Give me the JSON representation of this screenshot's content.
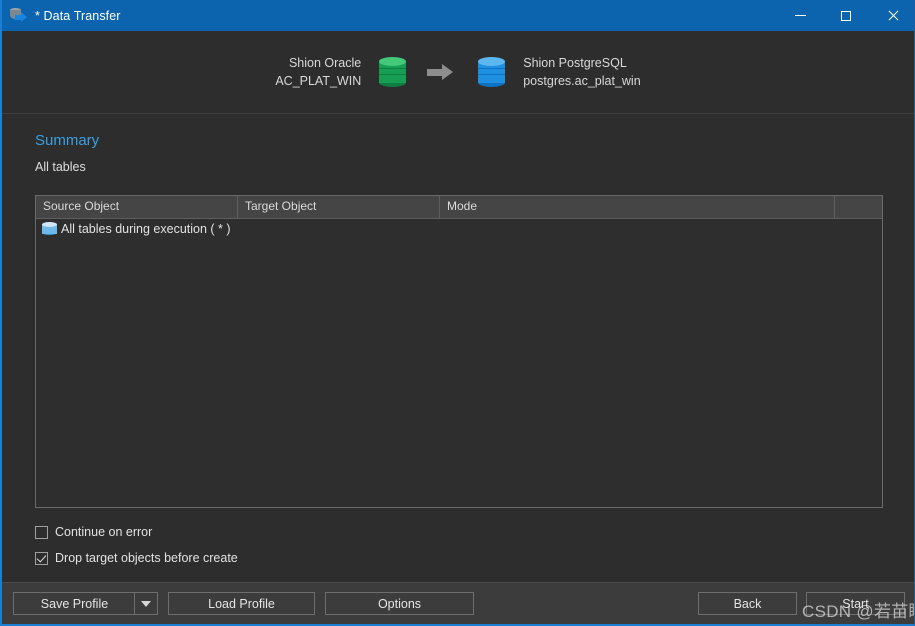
{
  "window": {
    "title": "* Data Transfer",
    "icon": "database-transfer-icon",
    "accent_color": "#0b64ad",
    "controls": {
      "minimize": "—",
      "maximize": "□",
      "close": "✕"
    }
  },
  "connection": {
    "source": {
      "name": "Shion Oracle",
      "schema": "AC_PLAT_WIN",
      "icon": "database-icon-green",
      "color": "#169e55"
    },
    "arrow": "arrow-right-icon",
    "target": {
      "name": "Shion PostgreSQL",
      "schema": "postgres.ac_plat_win",
      "icon": "database-icon-blue",
      "color": "#1f90e0"
    }
  },
  "summary": {
    "heading": "Summary",
    "heading_color": "#3a9fe0",
    "subtitle": "All tables"
  },
  "table": {
    "columns": [
      "Source Object",
      "Target Object",
      "Mode",
      ""
    ],
    "rows": [
      {
        "icon": "table-icon",
        "source_object": "All tables during execution ( * )",
        "target_object": "",
        "mode": ""
      }
    ]
  },
  "options": {
    "continue_on_error": {
      "label": "Continue on error",
      "checked": false
    },
    "drop_target_objects": {
      "label": "Drop target objects before create",
      "checked": true
    }
  },
  "footer": {
    "save_profile": "Save Profile",
    "save_profile_dropdown": "chevron-down-icon",
    "load_profile": "Load Profile",
    "options": "Options",
    "back": "Back",
    "start": "Start"
  },
  "watermark": {
    "text": "CSDN @若苗瞬"
  }
}
